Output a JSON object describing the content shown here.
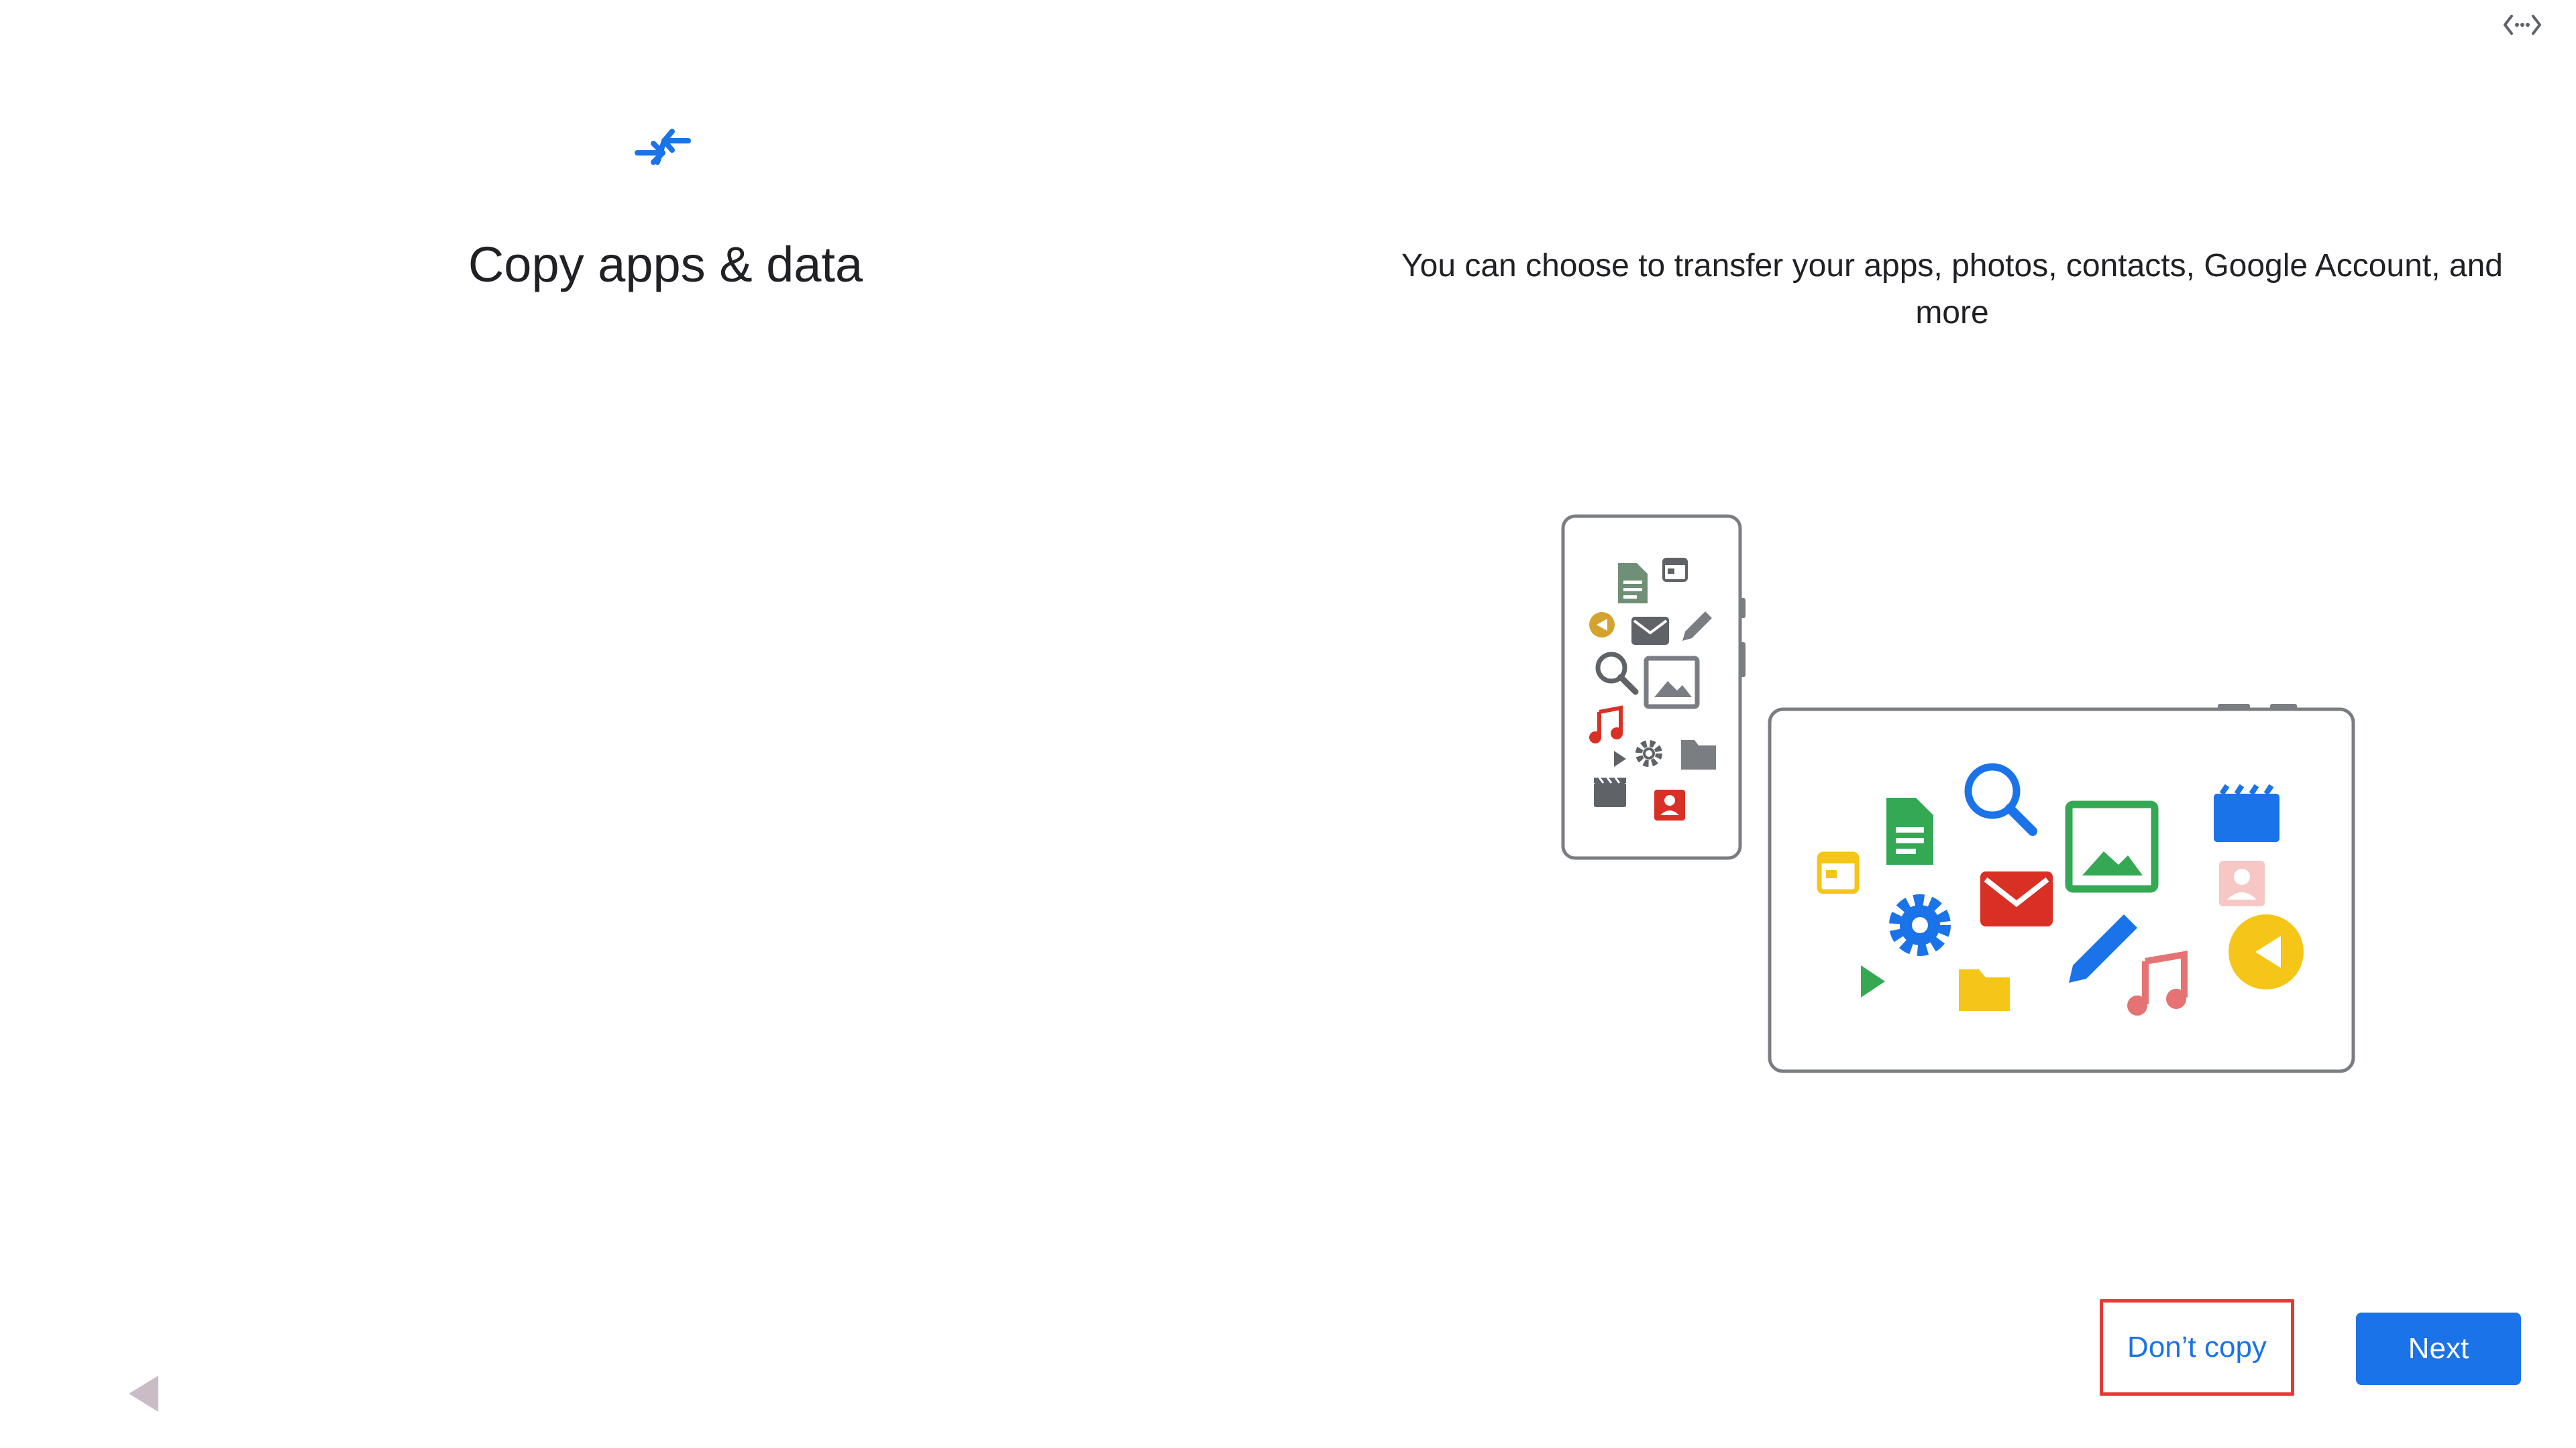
{
  "header": {
    "title": "Copy apps & data",
    "description": "You can choose to transfer your apps, photos, contacts, Google Account, and more",
    "icon": "transfer-arrows-icon"
  },
  "actions": {
    "secondary_label": "Don’t copy",
    "primary_label": "Next"
  },
  "status_bar": {
    "icon": "code-expand-icon"
  },
  "navigation": {
    "back_icon": "back-triangle-icon"
  },
  "colors": {
    "accent": "#1a73e8",
    "highlight_border": "#e53935",
    "text": "#202124",
    "device_outline": "#7a7d82"
  }
}
